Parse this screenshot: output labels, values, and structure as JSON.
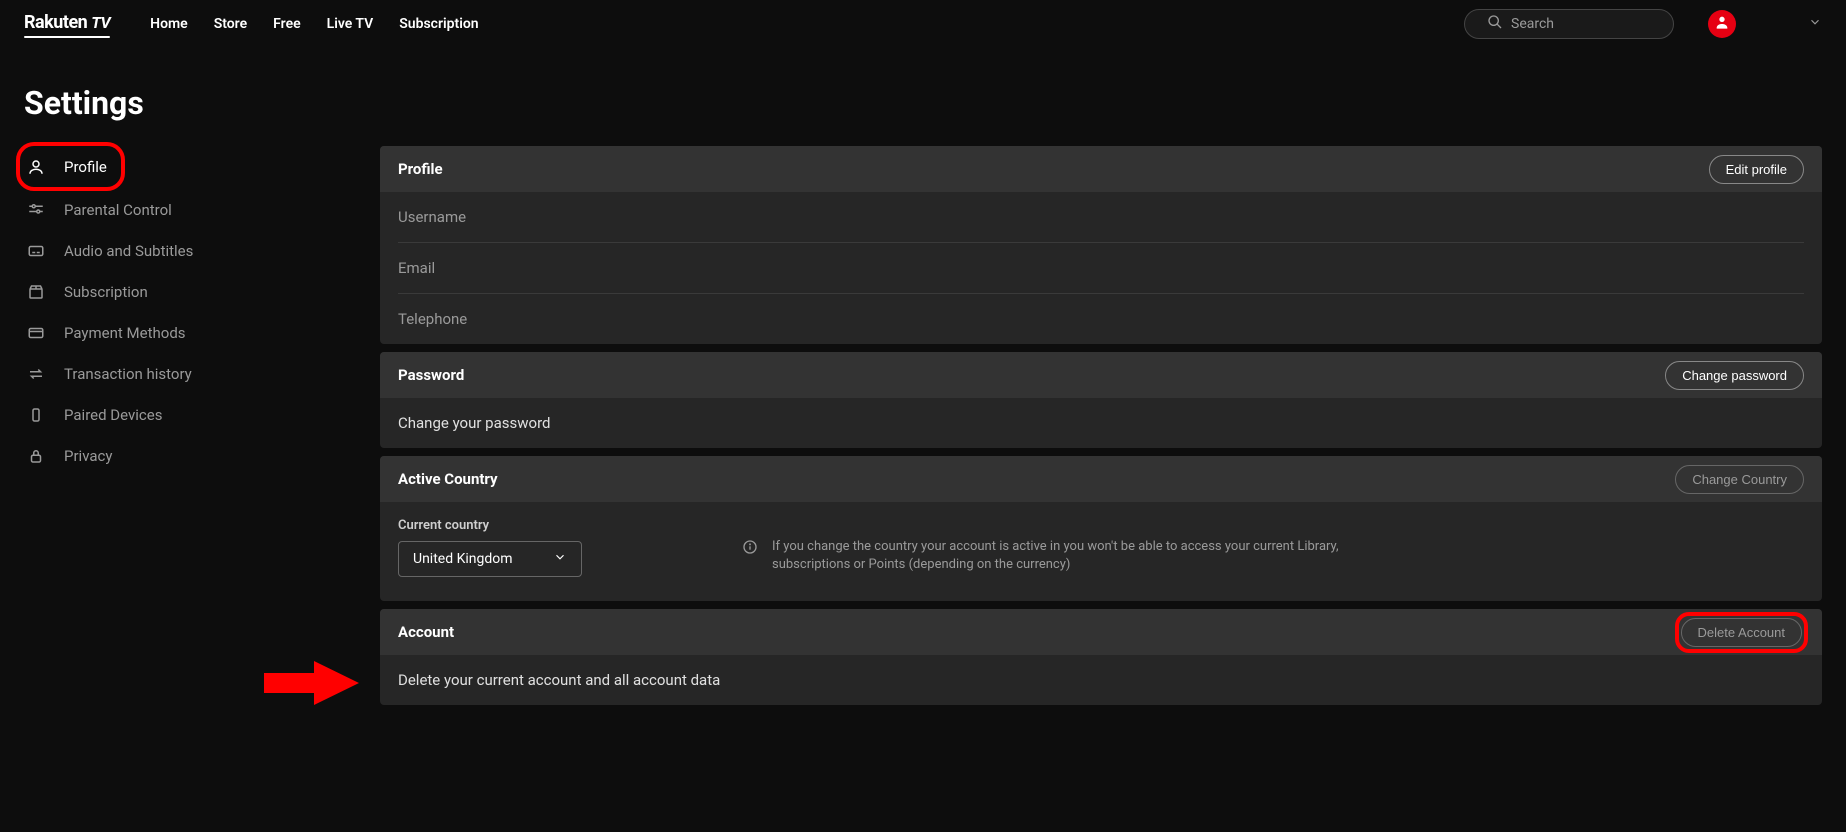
{
  "brand": {
    "name": "Rakuten",
    "suffix": "TV"
  },
  "nav": {
    "links": [
      "Home",
      "Store",
      "Free",
      "Live TV",
      "Subscription"
    ],
    "search_placeholder": "Search"
  },
  "page": {
    "title": "Settings"
  },
  "sidebar": {
    "items": [
      {
        "label": "Profile",
        "icon": "person"
      },
      {
        "label": "Parental Control",
        "icon": "sliders"
      },
      {
        "label": "Audio and Subtitles",
        "icon": "cc"
      },
      {
        "label": "Subscription",
        "icon": "box"
      },
      {
        "label": "Payment Methods",
        "icon": "card"
      },
      {
        "label": "Transaction history",
        "icon": "swap"
      },
      {
        "label": "Paired Devices",
        "icon": "device"
      },
      {
        "label": "Privacy",
        "icon": "lock"
      }
    ]
  },
  "profile_section": {
    "title": "Profile",
    "edit_btn": "Edit profile",
    "fields": [
      "Username",
      "Email",
      "Telephone"
    ]
  },
  "password_section": {
    "title": "Password",
    "change_btn": "Change password",
    "body": "Change your password"
  },
  "country_section": {
    "title": "Active Country",
    "change_btn": "Change Country",
    "current_label": "Current country",
    "current_value": "United Kingdom",
    "info": "If you change the country your account is active in you won't be able to access your current Library, subscriptions or Points (depending on the currency)"
  },
  "account_section": {
    "title": "Account",
    "delete_btn": "Delete Account",
    "body": "Delete your current account and all account data"
  }
}
